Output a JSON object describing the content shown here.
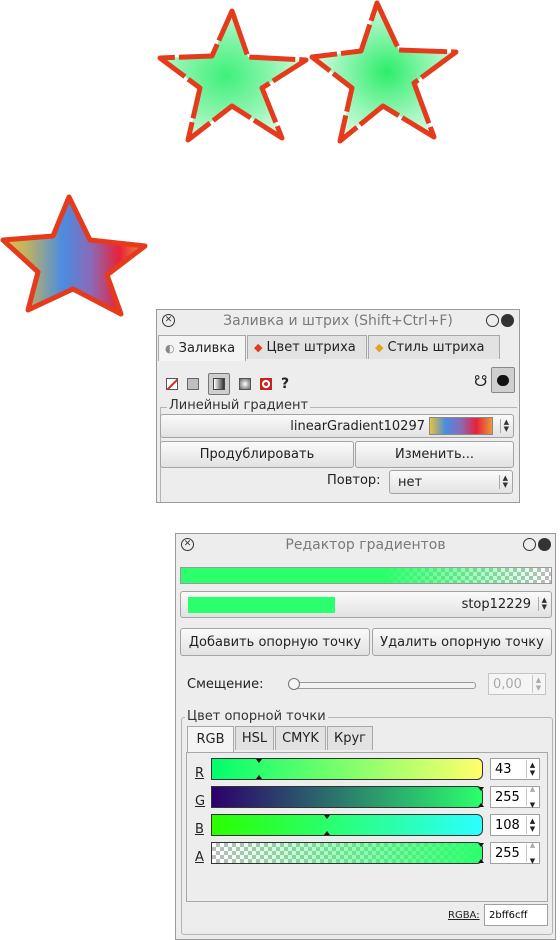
{
  "fill_stroke": {
    "title": "Заливка и штрих (Shift+Ctrl+F)",
    "tabs": [
      "Заливка",
      "Цвет штриха",
      "Стиль штриха"
    ],
    "help_glyph": "?",
    "frame_label": "Линейный градиент",
    "gradient_name": "linearGradient10297",
    "duplicate_label": "Продублировать",
    "edit_label": "Изменить...",
    "repeat_label": "Повтор:",
    "repeat_value": "нет",
    "icons": [
      "close-icon",
      "no-paint-icon",
      "flat-color-icon",
      "linear-gradient-icon",
      "radial-gradient-icon",
      "pattern-icon",
      "unset-paint-icon",
      "fill-rule-evenodd-icon",
      "fill-rule-nonzero-icon"
    ]
  },
  "gradient_editor": {
    "title": "Редактор градиентов",
    "stop_name": "stop12229",
    "add_stop_label": "Добавить опорную точку",
    "remove_stop_label": "Удалить опорную точку",
    "offset_label": "Смещение:",
    "offset_value": "0,00",
    "offset_fraction": 0.0,
    "stop_color_label": "Цвет опорной точки",
    "color_tabs": [
      "RGB",
      "HSL",
      "CMYK",
      "Круг"
    ],
    "channels": [
      {
        "letter": "R",
        "value": "43"
      },
      {
        "letter": "G",
        "value": "255"
      },
      {
        "letter": "B",
        "value": "108"
      },
      {
        "letter": "A",
        "value": "255"
      }
    ],
    "rgba_label": "RGBA:",
    "rgba_value": "2bff6cff",
    "colors": {
      "stop": "#2bff6c"
    }
  },
  "canvas": {
    "colors": {
      "star_stroke": "#e63a1c",
      "star_fill": "#3ef07a",
      "gradient_star": [
        "#e8c23a",
        "#4a8ce0",
        "#e8213a"
      ]
    }
  }
}
